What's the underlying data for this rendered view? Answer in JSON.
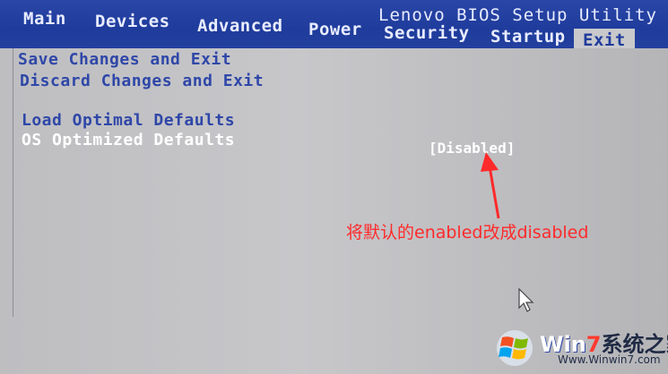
{
  "window": {
    "title": "Lenovo BIOS Setup Utility"
  },
  "tabs": [
    {
      "label": "Main"
    },
    {
      "label": "Devices"
    },
    {
      "label": "Advanced"
    },
    {
      "label": "Power"
    },
    {
      "label": "Security"
    },
    {
      "label": "Startup"
    },
    {
      "label": "Exit",
      "active": true
    }
  ],
  "menu": {
    "items": [
      {
        "label": "Save Changes and Exit"
      },
      {
        "label": "Discard Changes and Exit"
      },
      {
        "label": "Load Optimal Defaults"
      },
      {
        "label": "OS Optimized Defaults",
        "selected": true,
        "value": "[Disabled]"
      }
    ]
  },
  "annotation": {
    "text": "将默认的enabled改成disabled",
    "color": "#ff2a2a"
  },
  "watermark": {
    "brand_prefix": "Win",
    "brand_num": "7",
    "brand_suffix": "系统之家",
    "url": "Www.Winwin7.com"
  },
  "colors": {
    "header": "#1f3c9c",
    "menu_text": "#2f47a8",
    "selected_text": "#ffffff",
    "panel": "#c3c3c6"
  },
  "icons": [
    "mouse-cursor-icon",
    "windows-logo-icon",
    "red-arrow-icon"
  ]
}
